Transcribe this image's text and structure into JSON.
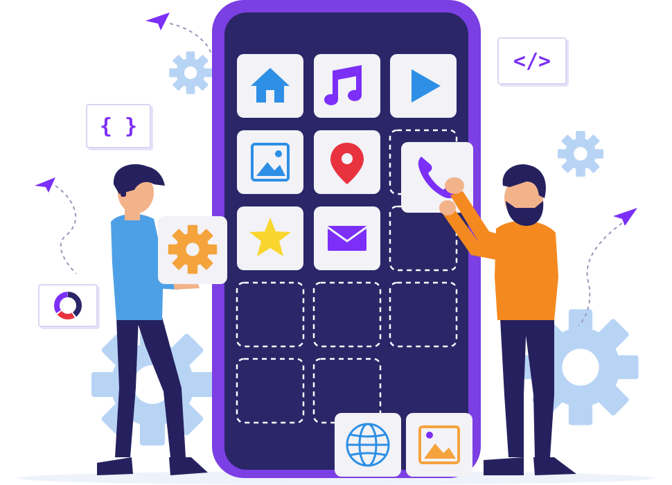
{
  "cards": {
    "html_tag": "</>",
    "braces": "{ }"
  },
  "colors": {
    "phone_frame": "#7b3fe4",
    "phone_screen": "#2a2668",
    "tile_bg": "#f2f2f7",
    "accent_purple": "#7b2ff7",
    "home_blue": "#2d8fe5",
    "play_blue": "#2d8fe5",
    "pin_red": "#e8333f",
    "star_yellow": "#f9d62e",
    "gear_orange": "#f5a33c",
    "gear_light_blue": "#b8d4f5",
    "man_left_shirt": "#4da0e6",
    "man_right_shirt": "#f48a1f",
    "pants": "#26215e",
    "skin": "#f3b38a",
    "hair": "#26215e"
  },
  "app_icons": [
    "home-icon",
    "music-note-icon",
    "play-icon",
    "image-icon",
    "location-pin-icon",
    "phone-call-icon",
    "star-icon",
    "mail-icon",
    "globe-icon",
    "photo-icon",
    "settings-gear-icon"
  ]
}
